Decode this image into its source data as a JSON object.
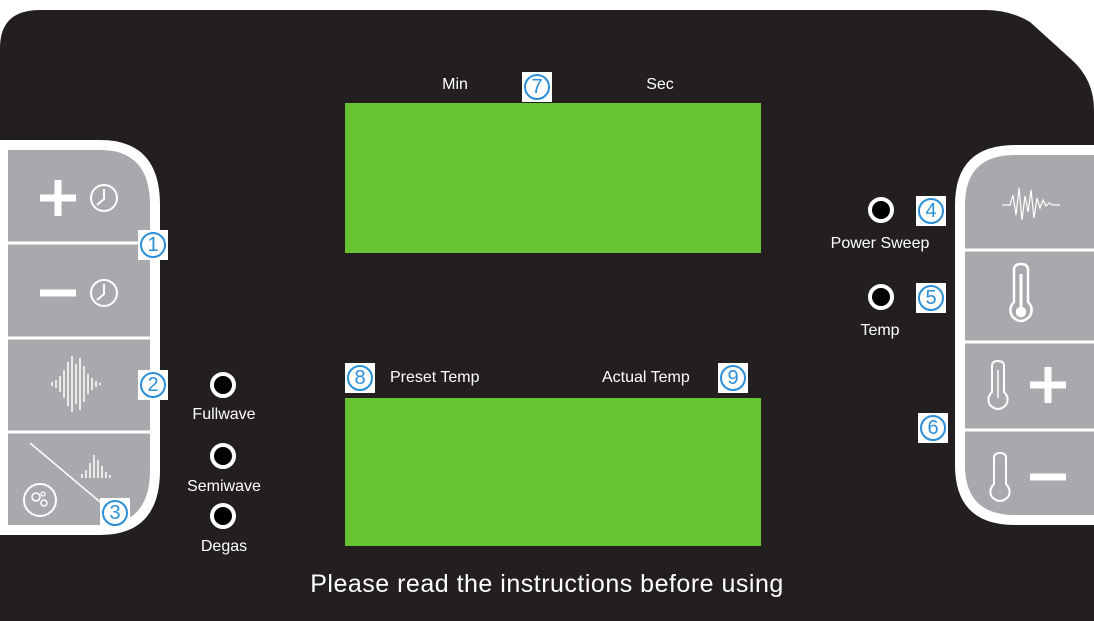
{
  "top_display": {
    "left_label": "Min",
    "right_label": "Sec",
    "callout": "7"
  },
  "bottom_display": {
    "left_label": "Preset Temp",
    "right_label": "Actual Temp",
    "left_callout": "8",
    "right_callout": "9"
  },
  "left_buttons": {
    "time_up_icon": "plus-clock-icon",
    "time_down_icon": "minus-clock-icon",
    "wave_icon": "ultrasonic-wave-icon",
    "degas_icon": "bubbles-icon",
    "callout_time": "1",
    "callout_mode": "2",
    "callout_degas": "3"
  },
  "modes": {
    "fullwave": "Fullwave",
    "semiwave": "Semiwave",
    "degas": "Degas"
  },
  "right_buttons": {
    "sweep_icon": "power-sweep-wave-icon",
    "temp_icon": "thermometer-icon",
    "temp_up_icon": "thermometer-plus-icon",
    "temp_down_icon": "thermometer-minus-icon",
    "callout_sweep": "4",
    "callout_temp": "5",
    "callout_adjust": "6"
  },
  "indicators": {
    "power_sweep": "Power Sweep",
    "temp": "Temp"
  },
  "footer_note": "Please read the instructions before using",
  "colors": {
    "panel": "#231f20",
    "button_face": "#a7a9ac",
    "lcd": "#66c332",
    "callout": "#2b8fd8"
  }
}
